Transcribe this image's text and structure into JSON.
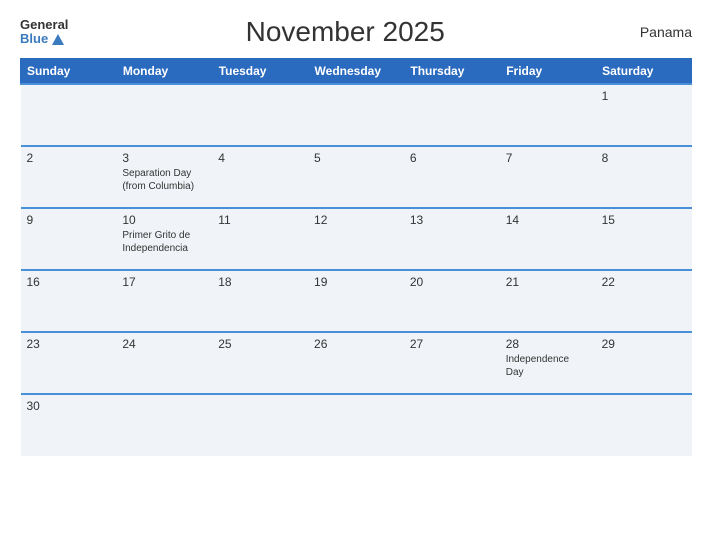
{
  "header": {
    "logo_general": "General",
    "logo_blue": "Blue",
    "title": "November 2025",
    "country": "Panama"
  },
  "weekdays": [
    "Sunday",
    "Monday",
    "Tuesday",
    "Wednesday",
    "Thursday",
    "Friday",
    "Saturday"
  ],
  "weeks": [
    [
      {
        "num": "",
        "event": ""
      },
      {
        "num": "",
        "event": ""
      },
      {
        "num": "",
        "event": ""
      },
      {
        "num": "",
        "event": ""
      },
      {
        "num": "",
        "event": ""
      },
      {
        "num": "",
        "event": ""
      },
      {
        "num": "1",
        "event": ""
      }
    ],
    [
      {
        "num": "2",
        "event": ""
      },
      {
        "num": "3",
        "event": "Separation Day\n(from Columbia)"
      },
      {
        "num": "4",
        "event": ""
      },
      {
        "num": "5",
        "event": ""
      },
      {
        "num": "6",
        "event": ""
      },
      {
        "num": "7",
        "event": ""
      },
      {
        "num": "8",
        "event": ""
      }
    ],
    [
      {
        "num": "9",
        "event": ""
      },
      {
        "num": "10",
        "event": "Primer Grito de\nIndependencia"
      },
      {
        "num": "11",
        "event": ""
      },
      {
        "num": "12",
        "event": ""
      },
      {
        "num": "13",
        "event": ""
      },
      {
        "num": "14",
        "event": ""
      },
      {
        "num": "15",
        "event": ""
      }
    ],
    [
      {
        "num": "16",
        "event": ""
      },
      {
        "num": "17",
        "event": ""
      },
      {
        "num": "18",
        "event": ""
      },
      {
        "num": "19",
        "event": ""
      },
      {
        "num": "20",
        "event": ""
      },
      {
        "num": "21",
        "event": ""
      },
      {
        "num": "22",
        "event": ""
      }
    ],
    [
      {
        "num": "23",
        "event": ""
      },
      {
        "num": "24",
        "event": ""
      },
      {
        "num": "25",
        "event": ""
      },
      {
        "num": "26",
        "event": ""
      },
      {
        "num": "27",
        "event": ""
      },
      {
        "num": "28",
        "event": "Independence Day"
      },
      {
        "num": "29",
        "event": ""
      }
    ],
    [
      {
        "num": "30",
        "event": ""
      },
      {
        "num": "",
        "event": ""
      },
      {
        "num": "",
        "event": ""
      },
      {
        "num": "",
        "event": ""
      },
      {
        "num": "",
        "event": ""
      },
      {
        "num": "",
        "event": ""
      },
      {
        "num": "",
        "event": ""
      }
    ]
  ]
}
